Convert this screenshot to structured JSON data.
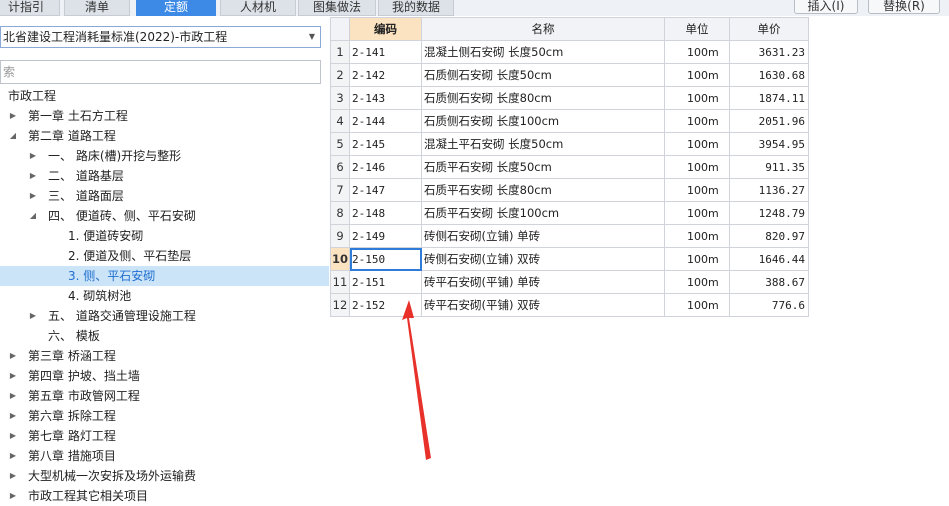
{
  "tabs": [
    {
      "label": "计指引",
      "active": false
    },
    {
      "label": "清单",
      "active": false
    },
    {
      "label": "定额",
      "active": true
    },
    {
      "label": "人材机",
      "active": false
    },
    {
      "label": "图集做法",
      "active": false
    },
    {
      "label": "我的数据",
      "active": false
    }
  ],
  "buttons": {
    "insert_label": "插入(I)",
    "replace_label": "替换(R)"
  },
  "library_select": {
    "value": "北省建设工程消耗量标准(2022)-市政工程"
  },
  "search": {
    "placeholder": "索"
  },
  "tree": [
    {
      "label": "市政工程",
      "level": 0,
      "arrow": "",
      "selected": false
    },
    {
      "label": "第一章 土石方工程",
      "level": 1,
      "arrow": "collapsed",
      "selected": false
    },
    {
      "label": "第二章 道路工程",
      "level": 1,
      "arrow": "expanded",
      "selected": false
    },
    {
      "label": "一、 路床(槽)开挖与整形",
      "level": 2,
      "arrow": "collapsed",
      "selected": false
    },
    {
      "label": "二、 道路基层",
      "level": 2,
      "arrow": "collapsed",
      "selected": false
    },
    {
      "label": "三、 道路面层",
      "level": 2,
      "arrow": "collapsed",
      "selected": false
    },
    {
      "label": "四、 便道砖、侧、平石安砌",
      "level": 2,
      "arrow": "expanded",
      "selected": false
    },
    {
      "label": "1. 便道砖安砌",
      "level": 3,
      "arrow": "",
      "selected": false
    },
    {
      "label": "2. 便道及侧、平石垫层",
      "level": 3,
      "arrow": "",
      "selected": false
    },
    {
      "label": "3. 侧、平石安砌",
      "level": 3,
      "arrow": "",
      "selected": true
    },
    {
      "label": "4. 砌筑树池",
      "level": 3,
      "arrow": "",
      "selected": false
    },
    {
      "label": "五、 道路交通管理设施工程",
      "level": 2,
      "arrow": "collapsed",
      "selected": false
    },
    {
      "label": "六、 模板",
      "level": 2,
      "arrow": "",
      "selected": false
    },
    {
      "label": "第三章 桥涵工程",
      "level": 1,
      "arrow": "collapsed",
      "selected": false
    },
    {
      "label": "第四章 护坡、挡土墙",
      "level": 1,
      "arrow": "collapsed",
      "selected": false
    },
    {
      "label": "第五章 市政管网工程",
      "level": 1,
      "arrow": "collapsed",
      "selected": false
    },
    {
      "label": "第六章 拆除工程",
      "level": 1,
      "arrow": "collapsed",
      "selected": false
    },
    {
      "label": "第七章 路灯工程",
      "level": 1,
      "arrow": "collapsed",
      "selected": false
    },
    {
      "label": "第八章 措施项目",
      "level": 1,
      "arrow": "collapsed",
      "selected": false
    },
    {
      "label": "大型机械一次安拆及场外运输费",
      "level": 1,
      "arrow": "collapsed",
      "selected": false
    },
    {
      "label": "市政工程其它相关项目",
      "level": 1,
      "arrow": "collapsed",
      "selected": false
    }
  ],
  "table": {
    "columns": [
      "",
      "编码",
      "名称",
      "单位",
      "单价"
    ],
    "current_row": 10,
    "rows": [
      {
        "no": "1",
        "code": "2-141",
        "name": "混凝土侧石安砌 长度50cm",
        "unit": "100m",
        "price": "3631.23"
      },
      {
        "no": "2",
        "code": "2-142",
        "name": "石质侧石安砌 长度50cm",
        "unit": "100m",
        "price": "1630.68"
      },
      {
        "no": "3",
        "code": "2-143",
        "name": "石质侧石安砌 长度80cm",
        "unit": "100m",
        "price": "1874.11"
      },
      {
        "no": "4",
        "code": "2-144",
        "name": "石质侧石安砌 长度100cm",
        "unit": "100m",
        "price": "2051.96"
      },
      {
        "no": "5",
        "code": "2-145",
        "name": "混凝土平石安砌 长度50cm",
        "unit": "100m",
        "price": "3954.95"
      },
      {
        "no": "6",
        "code": "2-146",
        "name": "石质平石安砌 长度50cm",
        "unit": "100m",
        "price": "911.35"
      },
      {
        "no": "7",
        "code": "2-147",
        "name": "石质平石安砌 长度80cm",
        "unit": "100m",
        "price": "1136.27"
      },
      {
        "no": "8",
        "code": "2-148",
        "name": "石质平石安砌 长度100cm",
        "unit": "100m",
        "price": "1248.79"
      },
      {
        "no": "9",
        "code": "2-149",
        "name": "砖侧石安砌(立铺) 单砖",
        "unit": "100m",
        "price": "820.97"
      },
      {
        "no": "10",
        "code": "2-150",
        "name": "砖侧石安砌(立铺) 双砖",
        "unit": "100m",
        "price": "1646.44"
      },
      {
        "no": "11",
        "code": "2-151",
        "name": "砖平石安砌(平铺) 单砖",
        "unit": "100m",
        "price": "388.67"
      },
      {
        "no": "12",
        "code": "2-152",
        "name": "砖平石安砌(平铺) 双砖",
        "unit": "100m",
        "price": "776.6"
      }
    ]
  },
  "annotation": {
    "color": "#e8312a"
  }
}
